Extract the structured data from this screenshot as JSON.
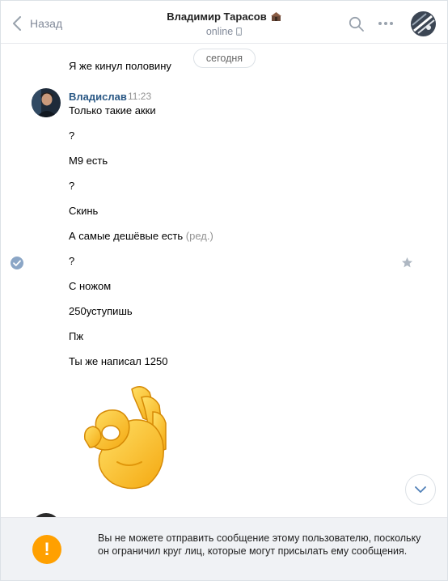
{
  "header": {
    "back_label": "Назад",
    "title": "Владимир Тарасов",
    "status": "online"
  },
  "chat": {
    "date_separator": "сегодня",
    "previous_message": "Я же кинул половину",
    "sender": "Владислав",
    "time": "11:23",
    "messages": [
      "Только такие акки",
      "?",
      "M9 есть",
      "?",
      "Скинь",
      "А самые дешёвые есть",
      "?",
      "С ножом",
      "250уступишь",
      "Пж",
      "Ты же написал 1250"
    ],
    "edited_label": "(ред.)",
    "sticker": "ok-hand-sticker"
  },
  "footer": {
    "notice": "Вы не можете отправить сообщение этому пользователю, поскольку он ограничил круг лиц, которые могут присылать ему сообщения.",
    "warn_symbol": "!"
  },
  "colors": {
    "accent": "#2a5885",
    "muted": "#828a99",
    "warning": "#ffa000",
    "check": "#8ba6c6"
  }
}
